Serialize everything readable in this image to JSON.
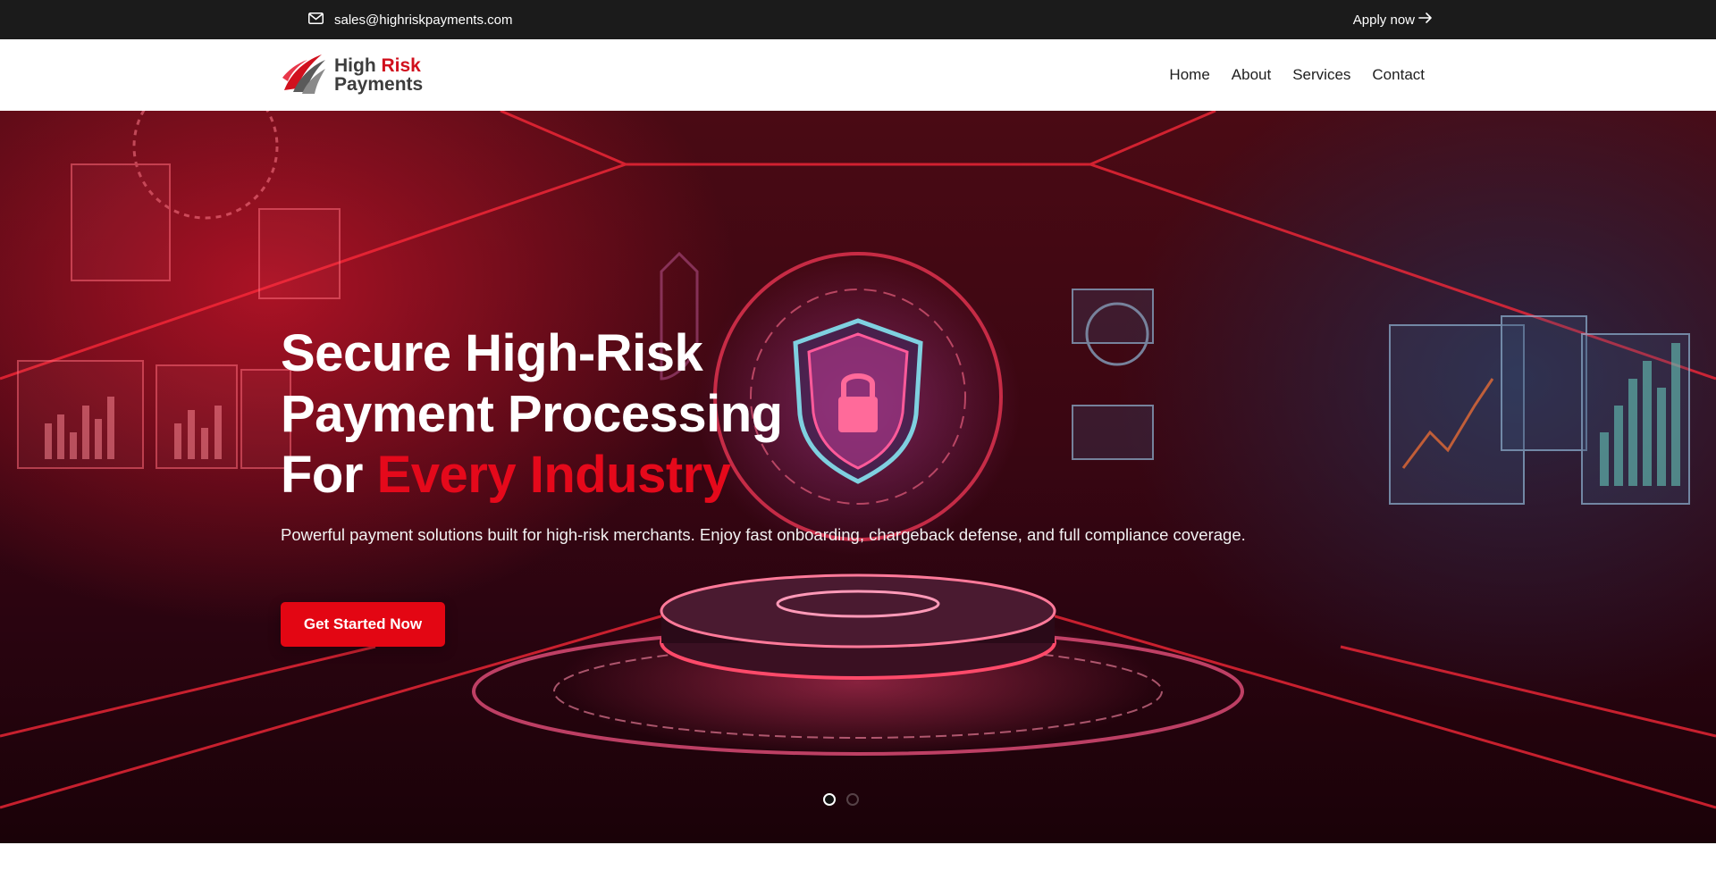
{
  "topbar": {
    "email": "sales@highriskpayments.com",
    "apply_label": "Apply now"
  },
  "header": {
    "logo": {
      "line1_prefix": "High",
      "line1_accent": "Risk",
      "line2": "Payments"
    },
    "nav": [
      {
        "label": "Home"
      },
      {
        "label": "About"
      },
      {
        "label": "Services"
      },
      {
        "label": "Contact"
      }
    ]
  },
  "hero": {
    "title_line1": "Secure High-Risk",
    "title_line2": "Payment Processing",
    "title_line3_prefix": "For",
    "title_line3_highlight": "Every Industry",
    "subtitle": "Powerful payment solutions built for high-risk merchants. Enjoy fast onboarding, chargeback defense, and full compliance coverage.",
    "cta_label": "Get Started Now",
    "slider": {
      "slides": 2,
      "active_index": 1
    }
  },
  "colors": {
    "topbar_bg": "#1b1b1b",
    "accent_red": "#e30613",
    "highlight_red": "#e5091b",
    "nav_text": "#1e1e1e"
  },
  "icons": {
    "email": "mail-icon",
    "apply": "arrow-right-icon",
    "logo": "swoosh-logo-icon"
  }
}
